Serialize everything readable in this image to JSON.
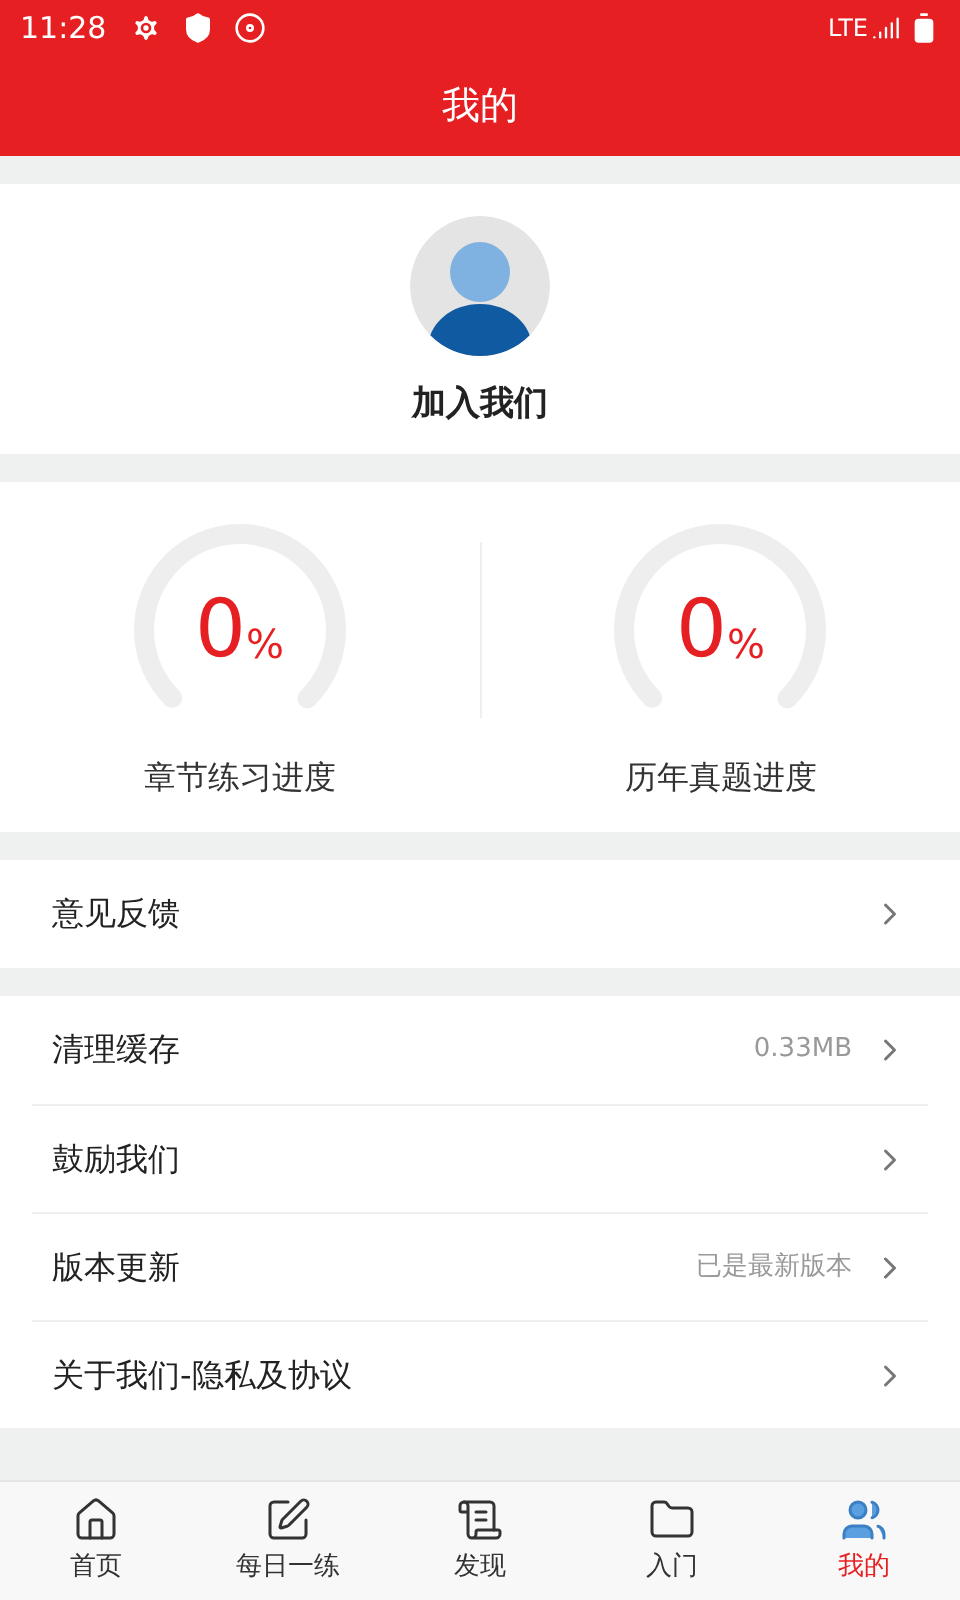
{
  "status_bar": {
    "time": "11:28",
    "network": "LTE"
  },
  "header": {
    "title": "我的"
  },
  "profile": {
    "name": "加入我们"
  },
  "progress": [
    {
      "value": "0",
      "unit": "%",
      "label": "章节练习进度"
    },
    {
      "value": "0",
      "unit": "%",
      "label": "历年真题进度"
    }
  ],
  "menu_groups": [
    [
      {
        "label": "意见反馈"
      }
    ],
    [
      {
        "label": "清理缓存",
        "detail": "0.33MB"
      },
      {
        "label": "鼓励我们"
      },
      {
        "label": "版本更新",
        "detail": "已是最新版本"
      },
      {
        "label": "关于我们-隐私及协议"
      }
    ]
  ],
  "tabs": [
    {
      "label": "首页",
      "kind": "home",
      "selected": false
    },
    {
      "label": "每日一练",
      "kind": "practice",
      "selected": false
    },
    {
      "label": "发现",
      "kind": "discover",
      "selected": false
    },
    {
      "label": "入门",
      "kind": "intro",
      "selected": false
    },
    {
      "label": "我的",
      "kind": "me",
      "selected": true
    }
  ]
}
